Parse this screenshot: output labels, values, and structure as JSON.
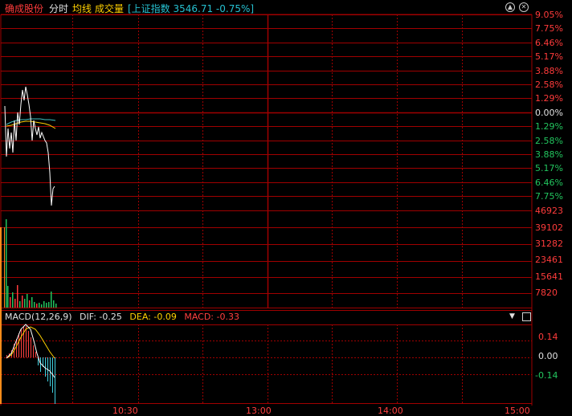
{
  "header": {
    "stock_name": "确成股份",
    "tab_intraday": "分时",
    "label_avg": "均线",
    "label_volume": "成交量",
    "index_info": "[上证指数 3546.71 -0.75%]"
  },
  "price_axis": {
    "up": [
      "9.05%",
      "7.75%",
      "6.46%",
      "5.17%",
      "3.88%",
      "2.58%",
      "1.29%"
    ],
    "zero": "0.00%",
    "down": [
      "1.29%",
      "2.58%",
      "3.88%",
      "5.17%",
      "6.46%",
      "7.75%"
    ]
  },
  "volume_axis": [
    "46923",
    "39102",
    "31282",
    "23461",
    "15641",
    "7820"
  ],
  "macd": {
    "title": "MACD(12,26,9)",
    "dif": "DIF: -0.25",
    "dea": "DEA: -0.09",
    "macd": "MACD: -0.33",
    "axis": [
      "0.14",
      "0.00",
      "-0.14"
    ]
  },
  "time_axis": [
    "10:30",
    "13:00",
    "14:00",
    "15:00"
  ],
  "colors": {
    "grid": "#a00000",
    "up": "#ff3b3b",
    "down": "#22c55e",
    "price_line": "#ffffff",
    "avg_line": "#ffd100",
    "index_line": "#3fc0c0",
    "macd_up": "#ff4040",
    "macd_down": "#40d0e0"
  },
  "icons": [
    "up-circle-icon",
    "close-circle-icon",
    "dropdown-icon"
  ]
}
